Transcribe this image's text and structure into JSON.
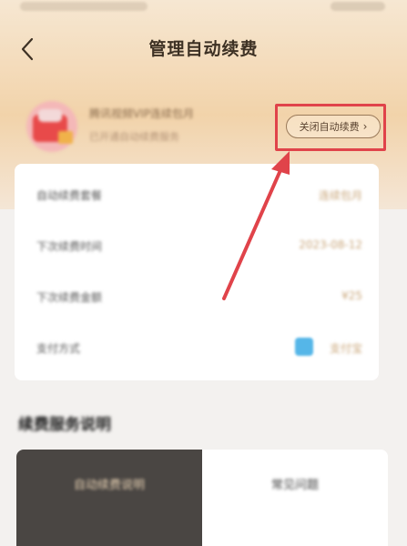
{
  "header": {
    "title": "管理自动续费",
    "back_icon": "chevron-left-icon"
  },
  "member": {
    "name": "腾讯视频VIP连续包月",
    "subtitle": "已开通自动续费服务"
  },
  "actions": {
    "close_renew_label": "关闭自动续费",
    "close_renew_chevron": "›"
  },
  "details": [
    {
      "label": "自动续费套餐",
      "value": "连续包月"
    },
    {
      "label": "下次续费时间",
      "value": "2023-08-12"
    },
    {
      "label": "下次续费金额",
      "value": "¥25"
    },
    {
      "label": "支付方式",
      "value": "支付宝"
    }
  ],
  "section": {
    "title": "续费服务说明"
  },
  "tabs": [
    {
      "label": "自动续费说明"
    },
    {
      "label": "常见问题"
    }
  ],
  "colors": {
    "highlight": "#e0434a",
    "accent_gold": "#c9a67a",
    "pay_blue": "#55b6e8"
  }
}
